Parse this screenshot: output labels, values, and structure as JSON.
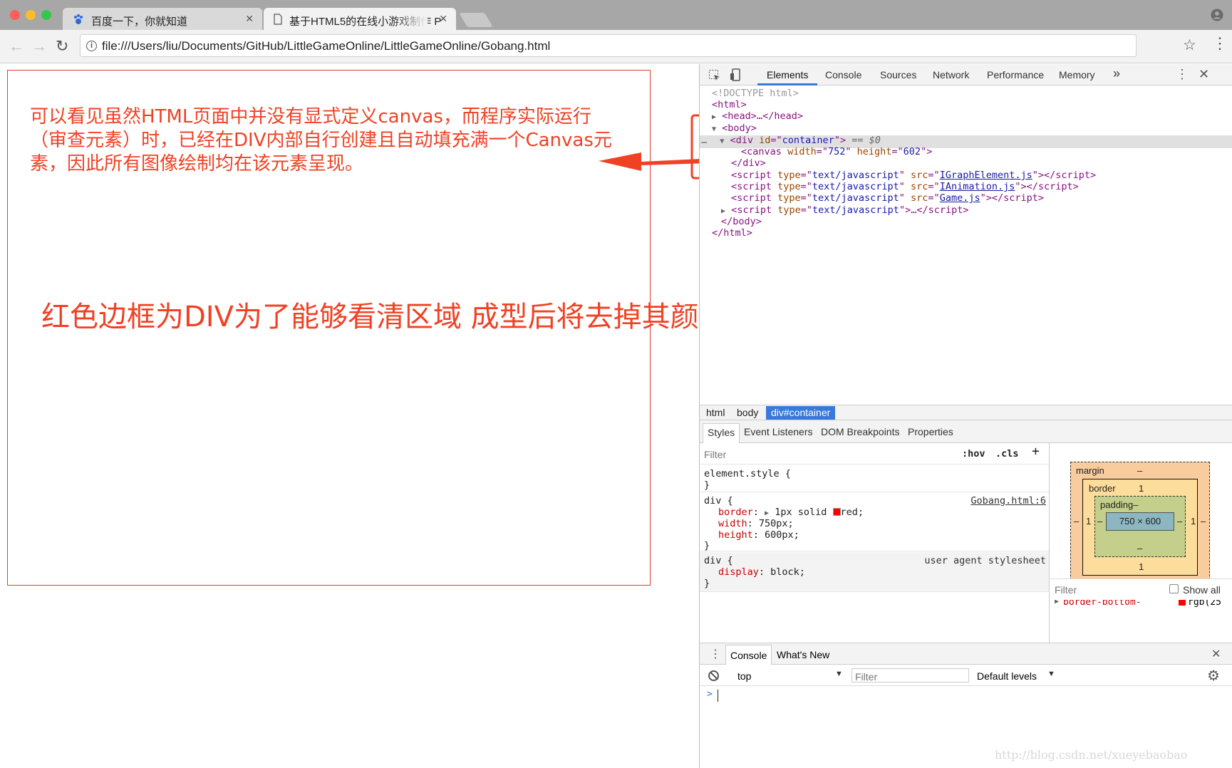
{
  "browser": {
    "tabs": [
      {
        "label": "百度一下，你就知道",
        "active": false
      },
      {
        "label": "基于HTML5的在线小游戏制作 P",
        "active": true
      }
    ],
    "address": "file:///Users/liu/Documents/GitHub/LittleGameOnline/LittleGameOnline/Gobang.html",
    "traffic_colors": {
      "close": "#fc5f57",
      "minimize": "#fdbc2e",
      "maximize": "#34c749"
    }
  },
  "page": {
    "note1": "可以看见虽然HTML页面中并没有显式定义canvas，而程序实际运行（审查元素）时，已经在DIV内部自行创建且自动填充满一个Canvas元素，因此所有图像绘制均在该元素呈现。",
    "note2": "红色边框为DIV为了能够看清区域 成型后将去掉其颜色",
    "annotation_color": "#f04124"
  },
  "devtools": {
    "tabs": [
      "Elements",
      "Console",
      "Sources",
      "Network",
      "Performance",
      "Memory"
    ],
    "active_tab": "Elements",
    "more": "»",
    "dom": {
      "doctype": "<!DOCTYPE html>",
      "html_open": "<html>",
      "head": "<head>…</head>",
      "body_open": "<body>",
      "div_tag": "div",
      "div_attr": "id",
      "div_val": "container",
      "div_suffix": "== $0",
      "canvas_tag": "canvas",
      "canvas_w_attr": "width",
      "canvas_w": "752",
      "canvas_h_attr": "height",
      "canvas_h": "602",
      "div_close": "</div>",
      "script_tag": "script",
      "script_type_attr": "type",
      "script_type": "text/javascript",
      "script_src_attr": "src",
      "scripts": [
        "IGraphElement.js",
        "IAnimation.js",
        "Game.js"
      ],
      "script_ellipsis": "…",
      "body_close": "</body>",
      "html_close": "</html>"
    },
    "breadcrumb": [
      "html",
      "body",
      "div#container"
    ],
    "styles_tabs": [
      "Styles",
      "Event Listeners",
      "DOM Breakpoints",
      "Properties"
    ],
    "filter_placeholder": "Filter",
    "hov": ":hov",
    "cls": ".cls",
    "plus": "+",
    "rules": {
      "element_style": "element.style {",
      "close_brace": "}",
      "div_selector": "div {",
      "div_source": "Gobang.html:6",
      "border_prop": "border",
      "border_val_a": "1px solid",
      "border_val_b": "red;",
      "width_prop": "width",
      "width_val": "750px;",
      "height_prop": "height",
      "height_val": "600px;",
      "ua_selector": "div {",
      "ua_source": "user agent stylesheet",
      "display_prop": "display",
      "display_val": "block;"
    },
    "box_model": {
      "margin_label": "margin",
      "margin_val": "–",
      "border_label": "border",
      "border_val": "1",
      "padding_label": "padding–",
      "content": "750 × 600",
      "dash": "–",
      "one": "1",
      "margin_color": "#f9cc9d",
      "border_color": "#fddd9b",
      "padding_color": "#c3cf8a",
      "content_color": "#8cb6c0"
    },
    "computed_filter": "Filter",
    "show_all": "Show all",
    "computed_prop": "border-bottom-",
    "computed_val": "rgb(25",
    "drawer_tabs": [
      "Console",
      "What's New"
    ],
    "context": "top",
    "console_filter": "Filter",
    "levels": "Default levels",
    "prompt": ">"
  },
  "watermark": "http://blog.csdn.net/xueyebaobao"
}
